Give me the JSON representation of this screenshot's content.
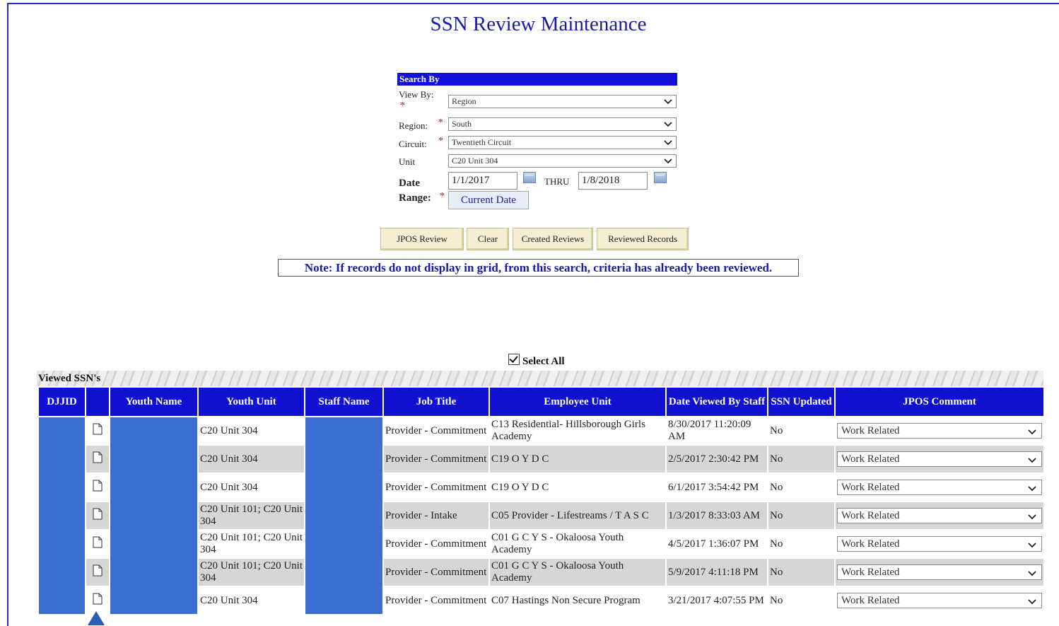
{
  "page": {
    "title": "SSN Review Maintenance"
  },
  "search": {
    "header": "Search By",
    "view_by_label": "View By:",
    "view_by_value": "Region",
    "region_label": "Region:",
    "region_value": "South",
    "circuit_label": "Circuit:",
    "circuit_value": "Twentieth Circuit",
    "unit_label": "Unit",
    "unit_value": "C20 Unit 304",
    "date_label": "Date",
    "range_label": "Range:",
    "required_marker": "*",
    "date_from": "1/1/2017",
    "thru_label": "THRU",
    "date_to": "1/8/2018",
    "current_date_button": "Current Date"
  },
  "actions": {
    "jpos_review": "JPOS Review",
    "clear": "Clear",
    "created_reviews": "Created Reviews",
    "reviewed_records": "Reviewed Records"
  },
  "note": "Note: If records do not display in grid, from this search, criteria has already been reviewed.",
  "select_all_label": "Select All",
  "select_all_checked": true,
  "grid": {
    "caption": "Viewed SSN's",
    "header_color": "#1010d0",
    "redaction_color": "#3a6fd0",
    "columns": [
      "DJJID",
      "",
      "Youth Name",
      "Youth Unit",
      "Staff Name",
      "Job Title",
      "Employee Unit",
      "Date Viewed By Staff",
      "SSN Updated",
      "JPOS Comment"
    ],
    "rows": [
      {
        "youth_unit": "C20 Unit 304",
        "job_title": "Provider - Commitment",
        "employee_unit": "C13 Residential- Hillsborough Girls Academy",
        "date_viewed": "8/30/2017 11:20:09 AM",
        "ssn_updated": "No",
        "jpos_comment": "Work Related"
      },
      {
        "youth_unit": "C20 Unit 304",
        "job_title": "Provider - Commitment",
        "employee_unit": "C19 O Y D C",
        "date_viewed": "2/5/2017 2:30:42 PM",
        "ssn_updated": "No",
        "jpos_comment": "Work Related"
      },
      {
        "youth_unit": "C20 Unit 304",
        "job_title": "Provider - Commitment",
        "employee_unit": "C19 O Y D C",
        "date_viewed": "6/1/2017 3:54:42 PM",
        "ssn_updated": "No",
        "jpos_comment": "Work Related"
      },
      {
        "youth_unit": "C20 Unit 101; C20 Unit 304",
        "job_title": "Provider - Intake",
        "employee_unit": "C05 Provider - Lifestreams / T A S C",
        "date_viewed": "1/3/2017 8:33:03 AM",
        "ssn_updated": "No",
        "jpos_comment": "Work Related"
      },
      {
        "youth_unit": "C20 Unit 101; C20 Unit 304",
        "job_title": "Provider - Commitment",
        "employee_unit": "C01 G C Y S - Okaloosa Youth Academy",
        "date_viewed": "4/5/2017 1:36:07 PM",
        "ssn_updated": "No",
        "jpos_comment": "Work Related"
      },
      {
        "youth_unit": "C20 Unit 101; C20 Unit 304",
        "job_title": "Provider - Commitment",
        "employee_unit": "C01 G C Y S - Okaloosa Youth Academy",
        "date_viewed": "5/9/2017 4:11:18 PM",
        "ssn_updated": "No",
        "jpos_comment": "Work Related"
      },
      {
        "youth_unit": "C20 Unit 304",
        "job_title": "Provider - Commitment",
        "employee_unit": "C07 Hastings Non Secure Program",
        "date_viewed": "3/21/2017 4:07:55 PM",
        "ssn_updated": "No",
        "jpos_comment": "Work Related"
      }
    ]
  },
  "icons": {
    "dropdown": "chevron-down-icon",
    "calendar": "calendar-icon",
    "document": "document-icon",
    "pointer": "arrow-marker"
  }
}
